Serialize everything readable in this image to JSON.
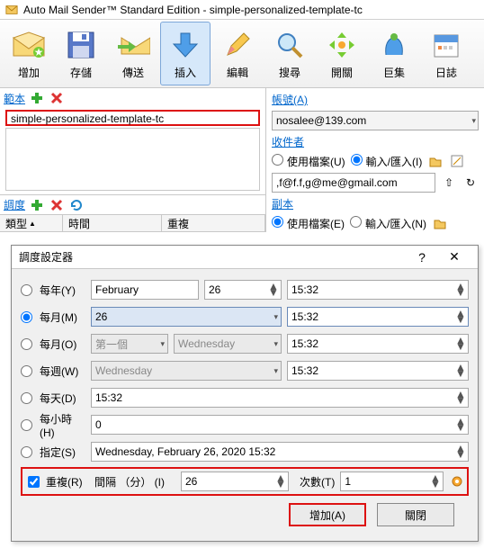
{
  "window": {
    "title": "Auto Mail Sender™ Standard Edition - simple-personalized-template-tc"
  },
  "toolbar": {
    "items": [
      {
        "label": "增加"
      },
      {
        "label": "存儲"
      },
      {
        "label": "傳送"
      },
      {
        "label": "插入"
      },
      {
        "label": "編輯"
      },
      {
        "label": "搜尋"
      },
      {
        "label": "開關"
      },
      {
        "label": "巨集"
      },
      {
        "label": "日誌"
      }
    ]
  },
  "template": {
    "section_label": "範本",
    "name": "simple-personalized-template-tc"
  },
  "schedule_list": {
    "section_label": "調度",
    "col_type": "類型",
    "col_time": "時間",
    "col_repeat": "重複"
  },
  "account": {
    "label": "帳號(A)",
    "value": "nosalee@139.com",
    "recipients_label": "收件者",
    "use_file": "使用檔案(U)",
    "input_import": "輸入/匯入(I)",
    "recipients_value": ",f@f.f,g@me@gmail.com",
    "cc_label": "副本",
    "use_file_e": "使用檔案(E)",
    "input_import_n": "輸入/匯入(N)"
  },
  "dialog": {
    "title": "調度設定器",
    "rows": {
      "yearly": "每年(Y)",
      "monthly": "每月(M)",
      "monthly_o": "每月(O)",
      "weekly": "每週(W)",
      "daily": "每天(D)",
      "hourly": "每小時(H)",
      "specify": "指定(S)"
    },
    "values": {
      "y_month": "February",
      "y_day": "26",
      "y_time": "15:32",
      "m_day": "26",
      "m_time": "15:32",
      "o_ord": "第一個",
      "o_dow": "Wednesday",
      "o_time": "15:32",
      "w_dow": "Wednesday",
      "w_time": "15:32",
      "d_time": "15:32",
      "h_min": "0",
      "s_full": "Wednesday,  February  26, 2020 15:32"
    },
    "repeat": {
      "label": "重複(R)",
      "interval_label": "間隔 （分） (I)",
      "interval_value": "26",
      "count_label": "次數(T)",
      "count_value": "1"
    },
    "buttons": {
      "add": "增加(A)",
      "close": "關閉"
    }
  }
}
